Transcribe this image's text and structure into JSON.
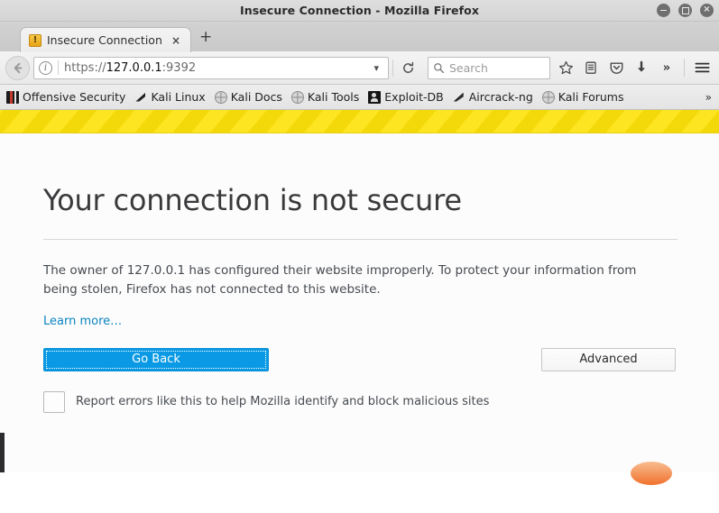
{
  "window": {
    "title": "Insecure Connection - Mozilla Firefox",
    "controls": {
      "minimize": "minimize-button",
      "maximize": "maximize-button",
      "close": "×"
    }
  },
  "tabs": {
    "active": {
      "title": "Insecure Connection",
      "favicon": "warning-icon",
      "favicon_glyph": "!",
      "close_label": "×"
    },
    "new_tab_label": "+"
  },
  "toolbar": {
    "back_glyph": "←",
    "info_glyph": "i",
    "url": {
      "scheme": "https://",
      "host": "127.0.0.1",
      "port": ":9392",
      "full": "https://127.0.0.1:9392"
    },
    "url_dropdown_glyph": "▾",
    "reload_glyph": "⟳",
    "search_placeholder": "Search",
    "icons": [
      {
        "name": "bookmark-star-icon",
        "glyph": "☆"
      },
      {
        "name": "library-icon",
        "glyph": "☰"
      },
      {
        "name": "pocket-icon",
        "glyph": "▼"
      },
      {
        "name": "downloads-icon",
        "glyph": "⬇"
      },
      {
        "name": "overflow-chevrons-icon",
        "glyph": "»"
      },
      {
        "name": "hamburger-menu-icon",
        "glyph": "≡"
      }
    ]
  },
  "bookmarks": {
    "items": [
      {
        "label": "Offensive Security",
        "icon": "offensive-security-icon"
      },
      {
        "label": "Kali Linux",
        "icon": "kali-dragon-icon"
      },
      {
        "label": "Kali Docs",
        "icon": "globe-icon"
      },
      {
        "label": "Kali Tools",
        "icon": "globe-icon"
      },
      {
        "label": "Exploit-DB",
        "icon": "exploit-db-icon"
      },
      {
        "label": "Aircrack-ng",
        "icon": "aircrack-icon"
      },
      {
        "label": "Kali Forums",
        "icon": "globe-icon"
      }
    ],
    "overflow_glyph": "»"
  },
  "error_page": {
    "title": "Your connection is not secure",
    "body": "The owner of 127.0.0.1 has configured their website improperly. To protect your information from being stolen, Firefox has not connected to this website.",
    "learn_more": "Learn more…",
    "go_back_label": "Go Back",
    "advanced_label": "Advanced",
    "report_checkbox_label": "Report errors like this to help Mozilla identify and block malicious sites",
    "report_checked": false
  },
  "colors": {
    "warning_stripe": "#f7dd15",
    "primary_button": "#0a9ae5",
    "link": "#0a84c1",
    "tab_favicon": "#e8a317"
  }
}
